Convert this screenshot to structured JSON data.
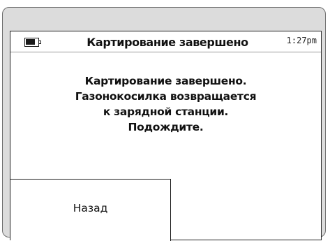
{
  "status_bar": {
    "battery_icon": "battery-icon",
    "battery_level": 0.8,
    "title": "Картирование завершено",
    "time": "1:27pm"
  },
  "message": {
    "lines": [
      "Картирование завершено.",
      "Газонокосилка возвращается",
      "к зарядной станции.",
      "Подождите."
    ]
  },
  "buttons": {
    "back_label": "Назад"
  }
}
